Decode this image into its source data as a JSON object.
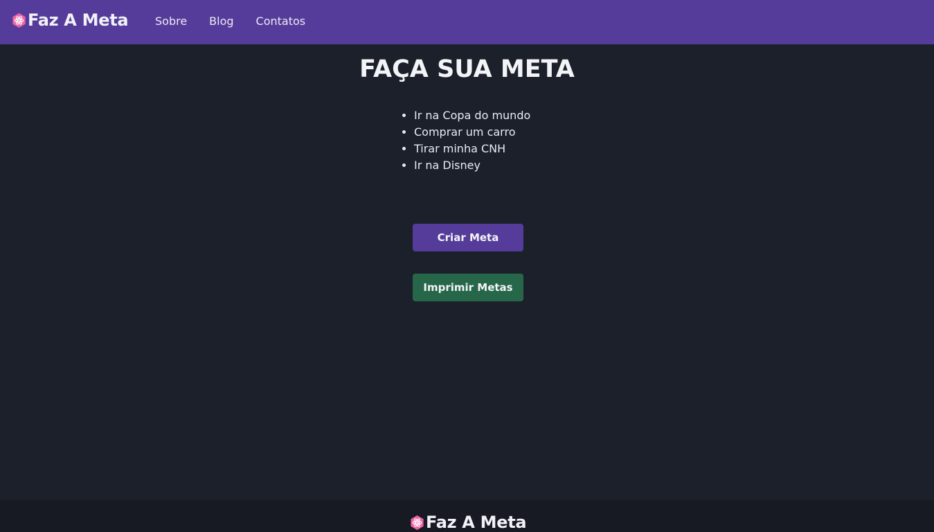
{
  "header": {
    "brand": "Faz A Meta",
    "logo_icon": "atom-hexagon-icon",
    "nav": [
      "Sobre",
      "Blog",
      "Contatos"
    ]
  },
  "main": {
    "title": "FAÇA SUA META",
    "goals": [
      "Ir na Copa do mundo",
      "Comprar um carro",
      "Tirar minha CNH",
      "Ir na Disney"
    ],
    "create_button": "Criar Meta",
    "print_button": "Imprimir Metas"
  },
  "footer": {
    "brand": "Faz A Meta",
    "logo_icon": "atom-hexagon-icon"
  },
  "colors": {
    "nav_bg": "#553c9a",
    "page_bg": "#1c202b",
    "footer_bg": "#171a23",
    "create_btn": "#553c9a",
    "print_btn": "#276749",
    "logo_accent": "#ed64a6"
  }
}
